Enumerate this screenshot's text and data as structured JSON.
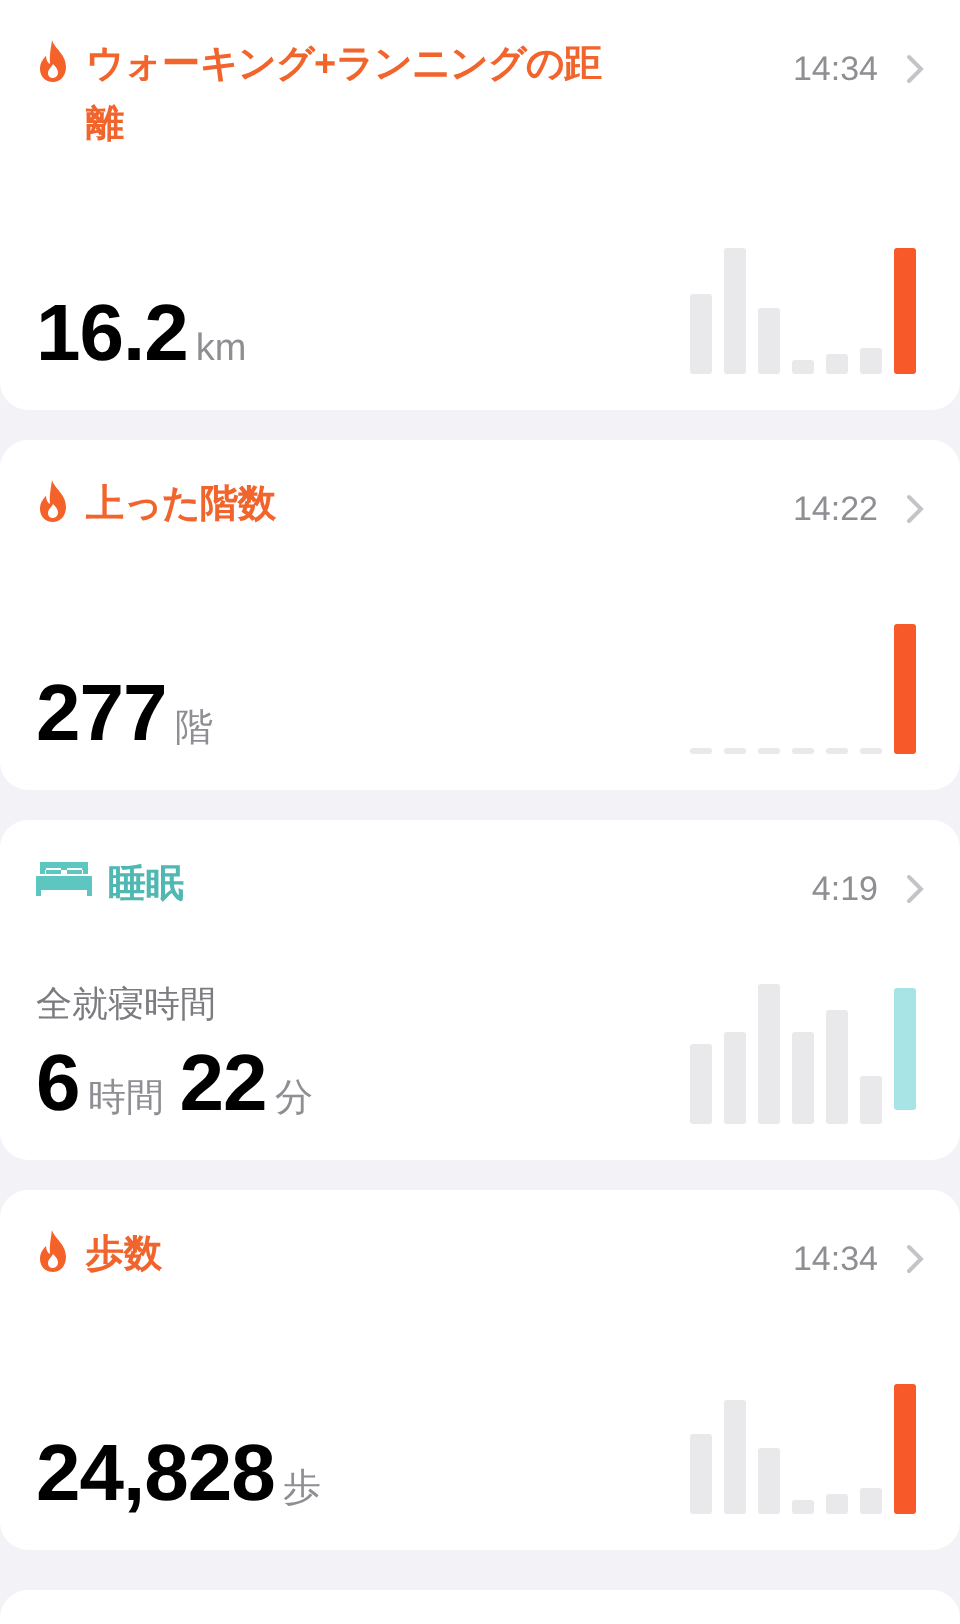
{
  "cards": [
    {
      "kind": "activity",
      "title": "ウォーキング+ランニングの距離",
      "time": "14:34",
      "value": [
        {
          "kind": "number",
          "text": "16.2"
        },
        {
          "kind": "unit",
          "text": "km"
        }
      ]
    },
    {
      "kind": "activity",
      "title": "上った階数",
      "time": "14:22",
      "value": [
        {
          "kind": "number",
          "text": "277"
        },
        {
          "kind": "unit",
          "text": "階"
        }
      ]
    },
    {
      "kind": "sleep",
      "title": "睡眠",
      "time": "4:19",
      "subtitle": "全就寝時間",
      "value": [
        {
          "kind": "number",
          "text": "6"
        },
        {
          "kind": "unit",
          "text": "時間"
        },
        {
          "kind": "number",
          "text": "22"
        },
        {
          "kind": "unit",
          "text": "分"
        }
      ]
    },
    {
      "kind": "activity",
      "title": "歩数",
      "time": "14:34",
      "value": [
        {
          "kind": "number",
          "text": "24,828"
        },
        {
          "kind": "unit",
          "text": "歩"
        }
      ]
    }
  ]
}
